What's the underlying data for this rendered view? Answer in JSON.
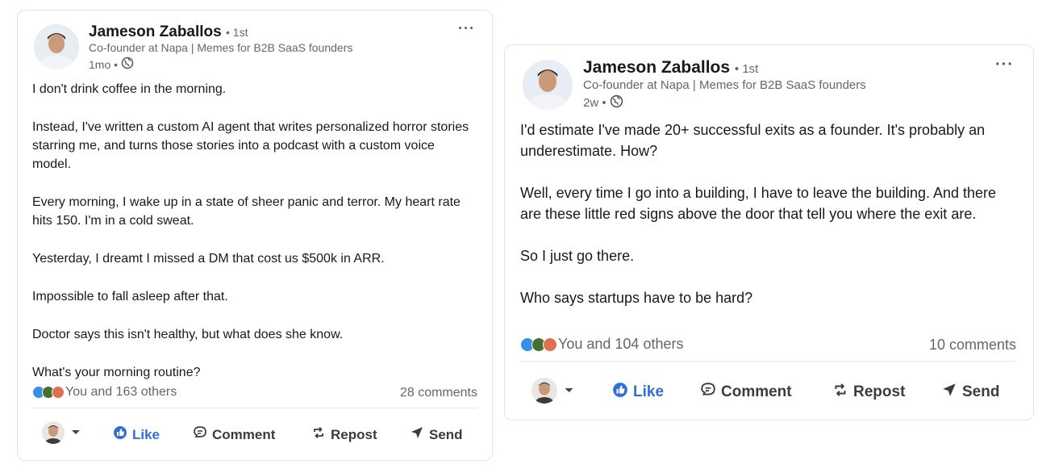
{
  "posts": [
    {
      "author": {
        "name": "Jameson Zaballos",
        "degree": "• 1st",
        "headline": "Co-founder at Napa | Memes for B2B SaaS founders",
        "time": "1mo •"
      },
      "body": [
        "I don't drink coffee in the morning.",
        "Instead, I've written a custom AI agent that writes personalized horror stories starring me, and turns those stories into a podcast with a custom voice model.",
        "Every morning, I wake up in a state of sheer panic and terror. My heart rate hits 150. I'm in a cold sweat.",
        "Yesterday, I dreamt I missed a DM that cost us $500k in ARR.",
        "Impossible to fall asleep after that.",
        "Doctor says this isn't healthy, but what does she know.",
        "What's your morning routine?"
      ],
      "reactions": "You and 163 others",
      "comments": "28 comments",
      "actions": {
        "like": "Like",
        "comment": "Comment",
        "repost": "Repost",
        "send": "Send"
      }
    },
    {
      "author": {
        "name": "Jameson Zaballos",
        "degree": "• 1st",
        "headline": "Co-founder at Napa | Memes for B2B SaaS founders",
        "time": "2w •"
      },
      "body": [
        "I'd estimate I've made 20+ successful exits as a founder. It's probably an underestimate. How?",
        "Well, every time I go into a building, I have to leave the building. And there are these little red signs above the door that tell you where the exit are.",
        "So I just go there.",
        "Who says startups have to be hard?"
      ],
      "reactions": "You and 104 others",
      "comments": "10 comments",
      "actions": {
        "like": "Like",
        "comment": "Comment",
        "repost": "Repost",
        "send": "Send"
      }
    }
  ],
  "colors": {
    "like_blue": "#2f6fd6",
    "celebrate_green": "#44712e",
    "love_red": "#df704d",
    "text_primary": "#191919",
    "text_secondary": "#666666"
  },
  "icons": [
    "more-icon",
    "globe-icon",
    "like-icon",
    "comment-icon",
    "repost-icon",
    "send-icon",
    "caret-down-icon"
  ]
}
